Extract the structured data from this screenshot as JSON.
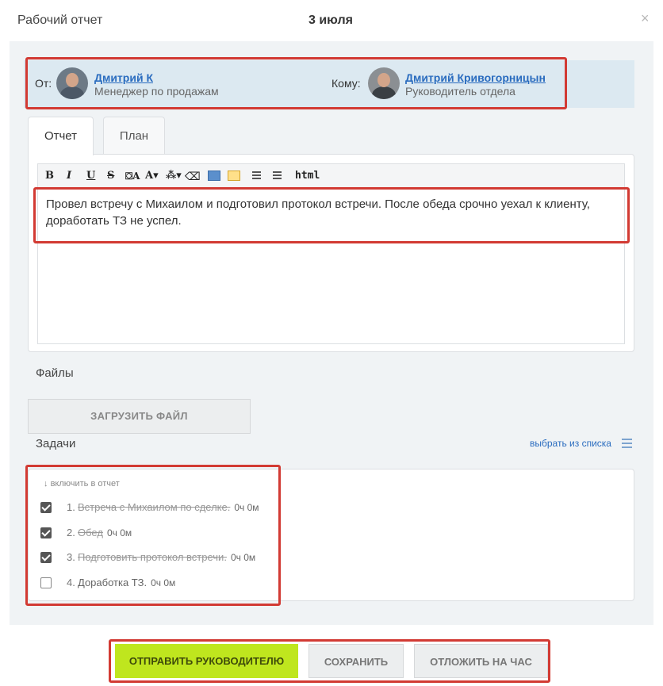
{
  "header": {
    "title": "Рабочий отчет",
    "date": "3 июля",
    "close": "×"
  },
  "from": {
    "label": "От:",
    "name": "Дмитрий К",
    "role": "Менеджер по продажам"
  },
  "to": {
    "label": "Кому:",
    "name": "Дмитрий Кривогорницын",
    "role": "Руководитель отдела"
  },
  "tabs": [
    {
      "label": "Отчет",
      "active": true
    },
    {
      "label": "План",
      "active": false
    }
  ],
  "toolbar": {
    "bold": "B",
    "italic": "I",
    "underline": "U",
    "strike": "S",
    "fontsize": "A",
    "html": "html"
  },
  "editor": {
    "text": "Провел встречу с Михаилом и подготовил протокол встречи. После обеда срочно уехал к клиенту, доработать ТЗ не успел."
  },
  "files": {
    "label": "Файлы",
    "upload": "ЗАГРУЗИТЬ ФАЙЛ"
  },
  "tasks": {
    "label": "Задачи",
    "pick": "выбрать из списка",
    "include": "включить в отчет",
    "items": [
      {
        "num": "1.",
        "title": "Встреча с Михаилом по сделке.",
        "time": "0ч 0м",
        "checked": true,
        "done": true
      },
      {
        "num": "2.",
        "title": "Обед",
        "time": "0ч 0м",
        "checked": true,
        "done": true
      },
      {
        "num": "3.",
        "title": "Подготовить протокол встречи.",
        "time": "0ч 0м",
        "checked": true,
        "done": true
      },
      {
        "num": "4.",
        "title": "Доработка ТЗ.",
        "time": "0ч 0м",
        "checked": false,
        "done": false
      }
    ]
  },
  "buttons": {
    "send": "ОТПРАВИТЬ РУКОВОДИТЕЛЮ",
    "save": "СОХРАНИТЬ",
    "later": "ОТЛОЖИТЬ НА ЧАС"
  },
  "colors": {
    "accent": "#bfe61e",
    "link": "#2a6cbf",
    "highlight": "#d23a33"
  }
}
